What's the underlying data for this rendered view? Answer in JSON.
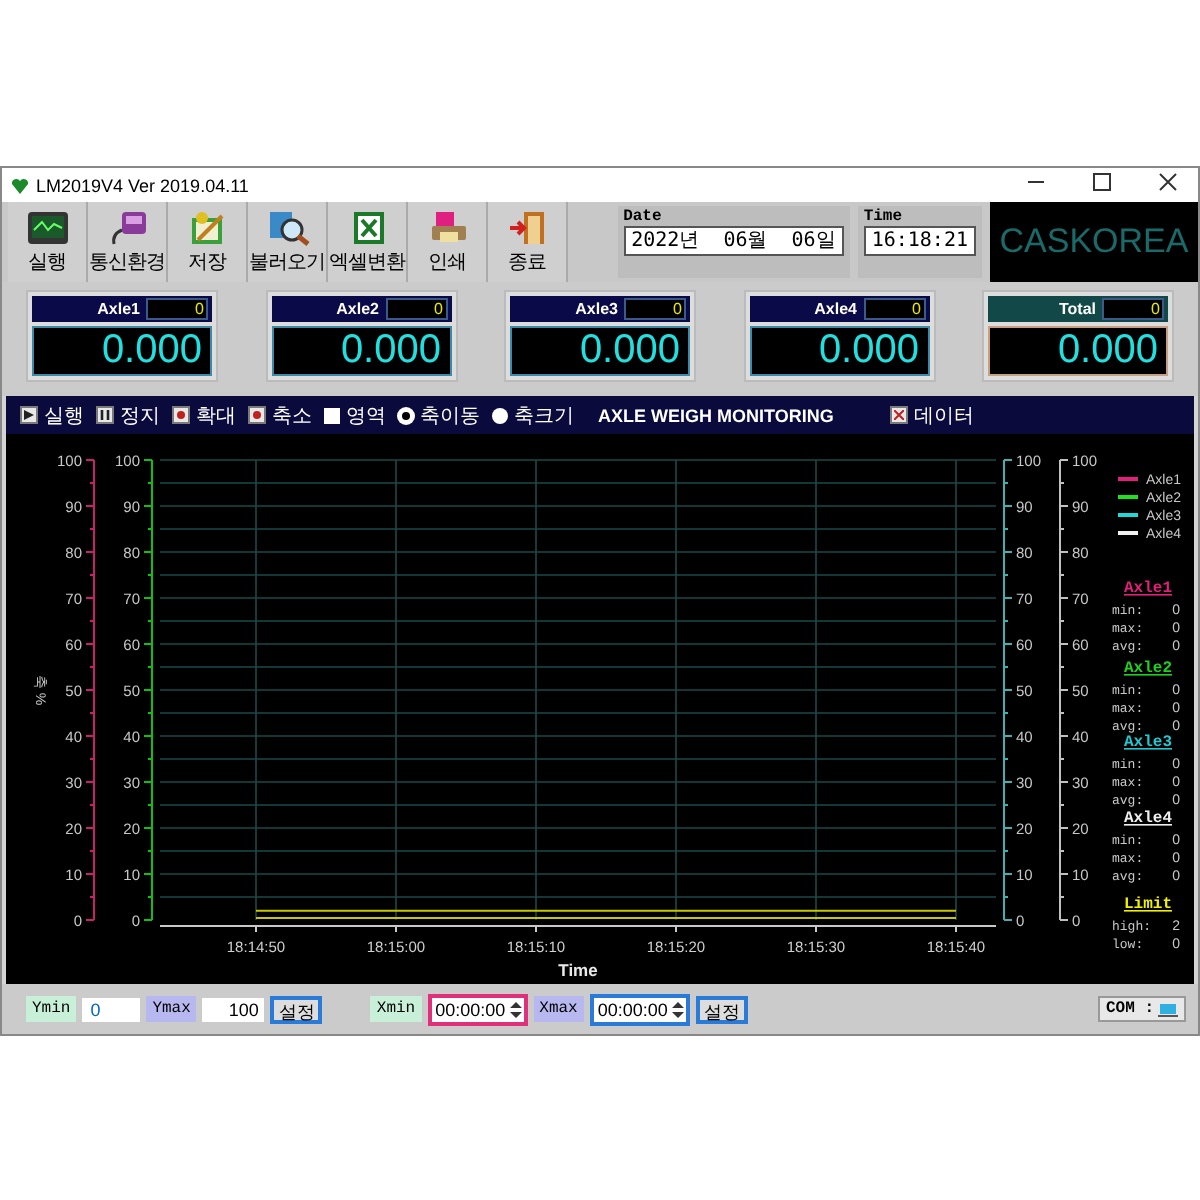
{
  "window": {
    "title": "LM2019V4  Ver 2019.04.11"
  },
  "toolbar": [
    {
      "label": "실행",
      "kind": "monitor"
    },
    {
      "label": "통신환경",
      "kind": "device"
    },
    {
      "label": "저장",
      "kind": "notepad"
    },
    {
      "label": "불러오기",
      "kind": "magnifier"
    },
    {
      "label": "엑셀변환",
      "kind": "spreadsheet"
    },
    {
      "label": "인쇄",
      "kind": "printer"
    },
    {
      "label": "종료",
      "kind": "door"
    }
  ],
  "date": {
    "label": "Date",
    "value": "2022년  06월  06일"
  },
  "time": {
    "label": "Time",
    "value": "16:18:21"
  },
  "logo": "CASKOREA",
  "axles": [
    {
      "name": "Axle1",
      "count": "0",
      "value": "0.000",
      "kind": "axle"
    },
    {
      "name": "Axle2",
      "count": "0",
      "value": "0.000",
      "kind": "axle"
    },
    {
      "name": "Axle3",
      "count": "0",
      "value": "0.000",
      "kind": "axle"
    },
    {
      "name": "Axle4",
      "count": "0",
      "value": "0.000",
      "kind": "axle"
    },
    {
      "name": "Total",
      "count": "0",
      "value": "0.000",
      "kind": "total"
    }
  ],
  "chart_toolbar": {
    "items": [
      {
        "label": "실행",
        "kind": "play"
      },
      {
        "label": "정지",
        "kind": "pause"
      },
      {
        "label": "확대",
        "kind": "zoom"
      },
      {
        "label": "축소",
        "kind": "zoom"
      },
      {
        "label": "영역",
        "kind": "checkbox",
        "checked": false
      },
      {
        "label": "축이동",
        "kind": "radio",
        "selected": true
      },
      {
        "label": "축크기",
        "kind": "radio",
        "selected": false
      }
    ],
    "title": "AXLE WEIGH MONITORING",
    "data_button": "데이터"
  },
  "chart": {
    "axes": [
      {
        "color": "#c8206a",
        "ticks": [
          "100",
          "90",
          "80",
          "70",
          "60",
          "50",
          "40",
          "30",
          "20",
          "10",
          "0"
        ]
      },
      {
        "color": "#10c010",
        "ticks": [
          "100",
          "90",
          "80",
          "70",
          "60",
          "50",
          "40",
          "30",
          "20",
          "10",
          "0"
        ]
      },
      {
        "color": "#40b0b0",
        "ticks": [
          "100",
          "90",
          "80",
          "70",
          "60",
          "50",
          "40",
          "30",
          "20",
          "10",
          "0"
        ]
      },
      {
        "color": "#c0c0c0",
        "ticks": [
          "100",
          "90",
          "80",
          "70",
          "60",
          "50",
          "40",
          "30",
          "20",
          "10",
          "0"
        ]
      }
    ],
    "legend": [
      {
        "name": "Axle1",
        "color": "#e0207a"
      },
      {
        "name": "Axle2",
        "color": "#20e020"
      },
      {
        "name": "Axle3",
        "color": "#20d8d8"
      },
      {
        "name": "Axle4",
        "color": "#f0f0f0"
      }
    ],
    "stats": [
      {
        "title": "Axle1",
        "color": "#e0207a",
        "rows": [
          {
            "label": "min:",
            "value": "0"
          },
          {
            "label": "max:",
            "value": "0"
          },
          {
            "label": "avg:",
            "value": "0"
          }
        ]
      },
      {
        "title": "Axle2",
        "color": "#20d020",
        "rows": [
          {
            "label": "min:",
            "value": "0"
          },
          {
            "label": "max:",
            "value": "0"
          },
          {
            "label": "avg:",
            "value": "0"
          }
        ]
      },
      {
        "title": "Axle3",
        "color": "#20c8d0",
        "rows": [
          {
            "label": "min:",
            "value": "0"
          },
          {
            "label": "max:",
            "value": "0"
          },
          {
            "label": "avg:",
            "value": "0"
          }
        ]
      },
      {
        "title": "Axle4",
        "color": "#f0f0f0",
        "rows": [
          {
            "label": "min:",
            "value": "0"
          },
          {
            "label": "max:",
            "value": "0"
          },
          {
            "label": "avg:",
            "value": "0"
          }
        ]
      },
      {
        "title": "Limit",
        "color": "#f0f000",
        "rows": [
          {
            "label": "high:",
            "value": "2"
          },
          {
            "label": "low:",
            "value": "0"
          }
        ]
      }
    ],
    "chart_data": {
      "type": "line",
      "xlabel": "Time",
      "annotations": [
        {
          "text": "축 %"
        }
      ],
      "grid": true,
      "categories": [
        "18:14:50",
        "18:15:00",
        "18:15:10",
        "18:15:20",
        "18:15:30",
        "18:15:40"
      ],
      "series": [
        {
          "color": "#c8c800",
          "values": [
            2,
            2,
            2,
            2,
            2,
            2
          ]
        },
        {
          "color": "#c8c800",
          "values": [
            0,
            0,
            0,
            0,
            0,
            0
          ]
        }
      ],
      "ylim": [
        0,
        100
      ],
      "yticks": [
        0,
        10,
        20,
        30,
        40,
        50,
        60,
        70,
        80,
        90,
        100
      ]
    }
  },
  "range": {
    "ymin": {
      "label": "Ymin",
      "value": "0"
    },
    "ymax": {
      "label": "Ymax",
      "value": "100"
    },
    "apply_y": "설정",
    "xmin": {
      "label": "Xmin",
      "value": "00:00:00"
    },
    "xmax": {
      "label": "Xmax",
      "value": "00:00:00"
    },
    "apply_x": "설정"
  },
  "status": {
    "label": "COM :"
  }
}
